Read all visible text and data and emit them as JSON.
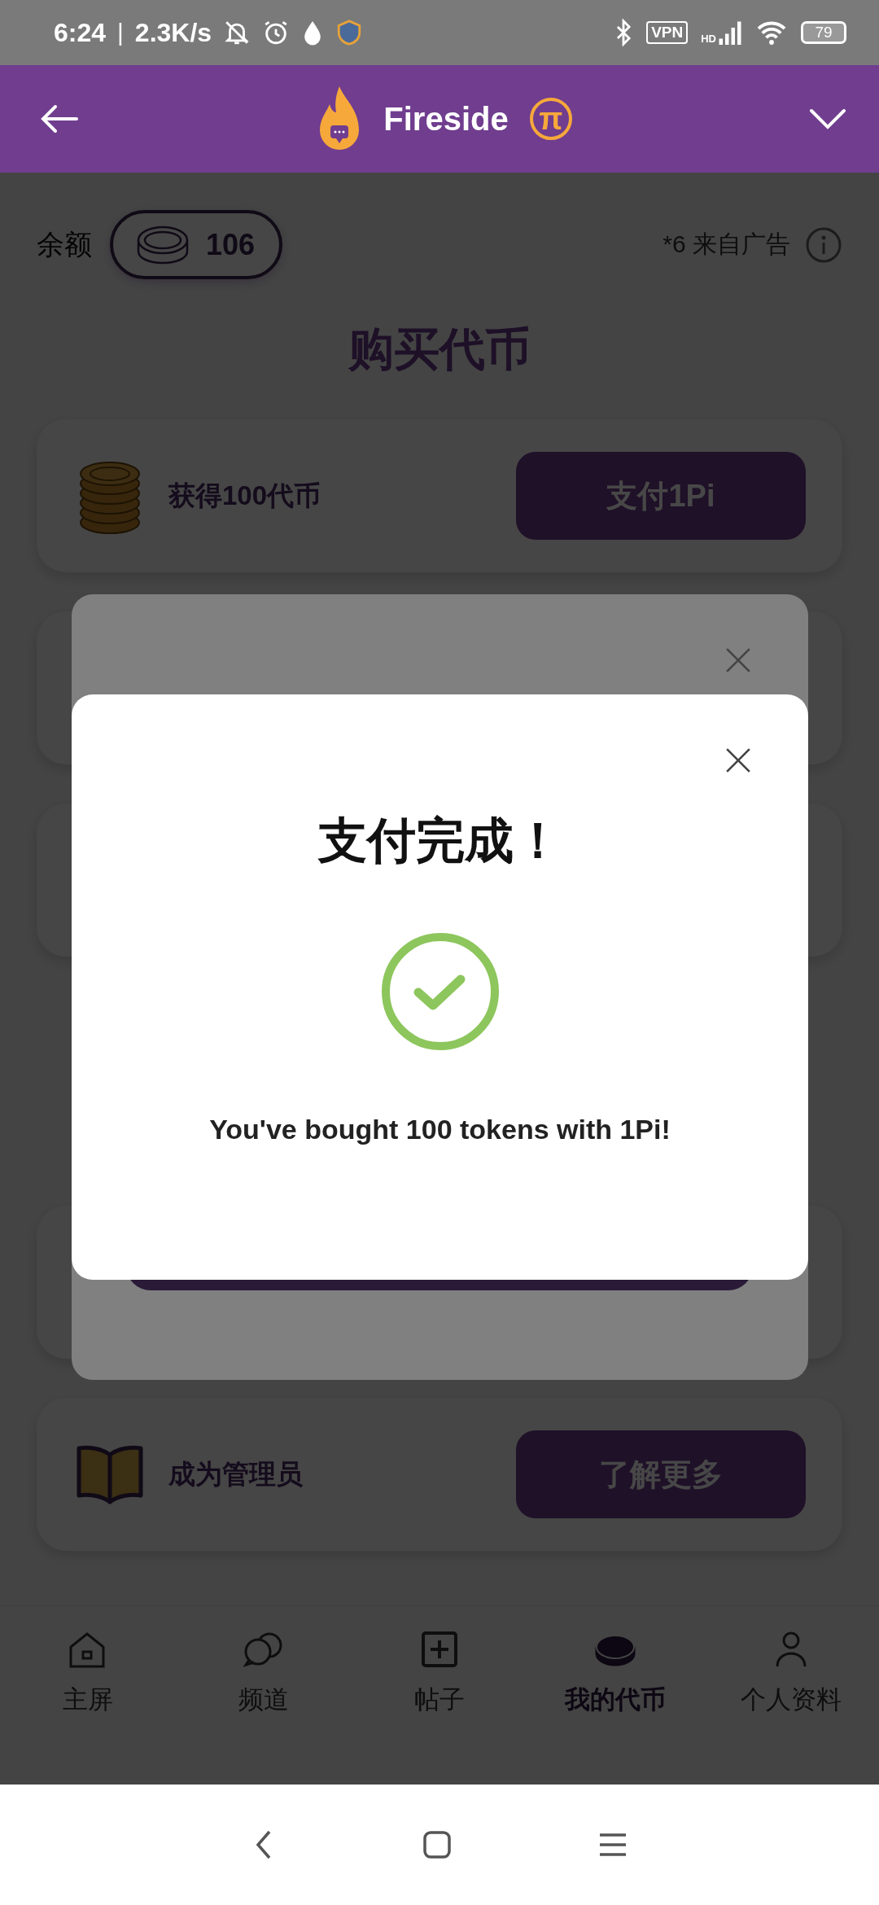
{
  "status_bar": {
    "time": "6:24",
    "separator": "|",
    "net_speed": "2.3K/s",
    "vpn": "VPN",
    "hd": "HD",
    "battery": "79"
  },
  "header": {
    "title": "Fireside",
    "badge": "π"
  },
  "balance": {
    "label": "余额",
    "amount": "106",
    "ad_note": "*6 来自广告"
  },
  "page_title": "购买代币",
  "offers": [
    {
      "kind": "coins",
      "label": "获得100代币",
      "button": "支付1Pi"
    },
    {
      "kind": "covered"
    },
    {
      "kind": "covered"
    },
    {
      "kind": "covered"
    },
    {
      "kind": "book",
      "label": "成为管理员",
      "button": "了解更多"
    }
  ],
  "dialogs": [
    {
      "kind": "covered"
    },
    {
      "kind": "success",
      "title": "支付完成！",
      "message": "You've bought 100 tokens with 1Pi!"
    }
  ],
  "tabs": [
    {
      "label": "主屏",
      "selected": false
    },
    {
      "label": "频道",
      "selected": false
    },
    {
      "label": "帖子",
      "selected": false
    },
    {
      "label": "我的代币",
      "selected": true
    },
    {
      "label": "个人资料",
      "selected": false
    }
  ]
}
